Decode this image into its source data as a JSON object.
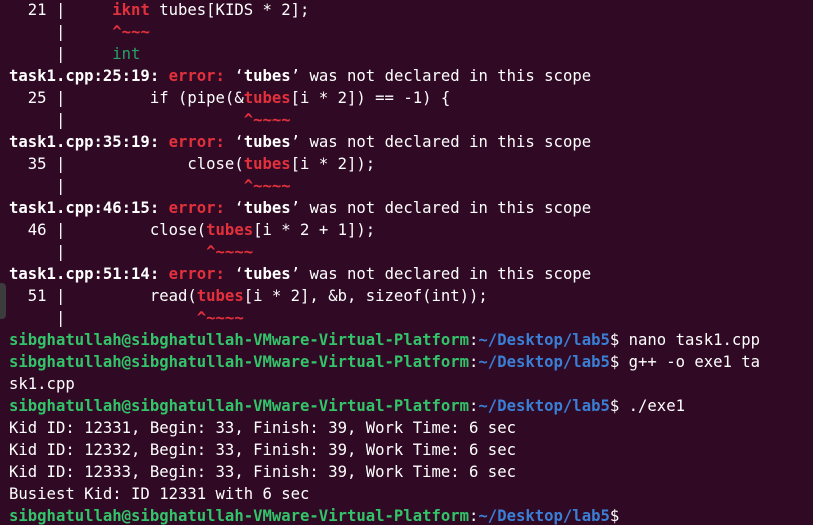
{
  "terminal": {
    "prompt": {
      "user_host": "sibghatullah@sibghatullah-VMware-Virtual-Platform",
      "colon": ":",
      "path": "~/Desktop/lab5",
      "dollar": "$"
    },
    "lines": {
      "l1_num": "  21 |     ",
      "l1_kw": "iknt",
      "l1_rest": " tubes[KIDS * 2];",
      "l2_bar": "     |     ",
      "l2_caret": "^~~~",
      "l3_bar": "     |     ",
      "l3_fix": "int",
      "err_label": "error:",
      "err_msg_pre": " ‘",
      "err_ident": "tubes",
      "err_msg_post": "’ was not declared in this scope",
      "e1_loc": "task1.cpp:25:19:",
      "e1_num": "  25 |         if (pipe(&",
      "e1_hl": "tubes",
      "e1_rest": "[i * 2]) == -1) {",
      "e1_bar": "     |                   ",
      "e1_caret": "^~~~~",
      "e2_loc": "task1.cpp:35:19:",
      "e2_num": "  35 |             close(",
      "e2_hl": "tubes",
      "e2_rest": "[i * 2]);",
      "e2_bar": "     |                   ",
      "e2_caret": "^~~~~",
      "e3_loc": "task1.cpp:46:15:",
      "e3_num": "  46 |         close(",
      "e3_hl": "tubes",
      "e3_rest": "[i * 2 + 1]);",
      "e3_bar": "     |               ",
      "e3_caret": "^~~~~",
      "e4_loc": "task1.cpp:51:14:",
      "e4_num": "  51 |         read(",
      "e4_hl": "tubes",
      "e4_rest": "[i * 2], &b, sizeof(int));",
      "e4_bar": "     |              ",
      "e4_caret": "^~~~~",
      "cmd1": " nano task1.cpp",
      "cmd2": " g++ -o exe1 ta",
      "cmd2_wrap": "sk1.cpp",
      "cmd3": " ./exe1",
      "out1": "Kid ID: 12331, Begin: 33, Finish: 39, Work Time: 6 sec",
      "out2": "Kid ID: 12332, Begin: 33, Finish: 39, Work Time: 6 sec",
      "out3": "Kid ID: 12333, Begin: 33, Finish: 39, Work Time: 6 sec",
      "out4": "Busiest Kid: ID 12331 with 6 sec"
    }
  }
}
